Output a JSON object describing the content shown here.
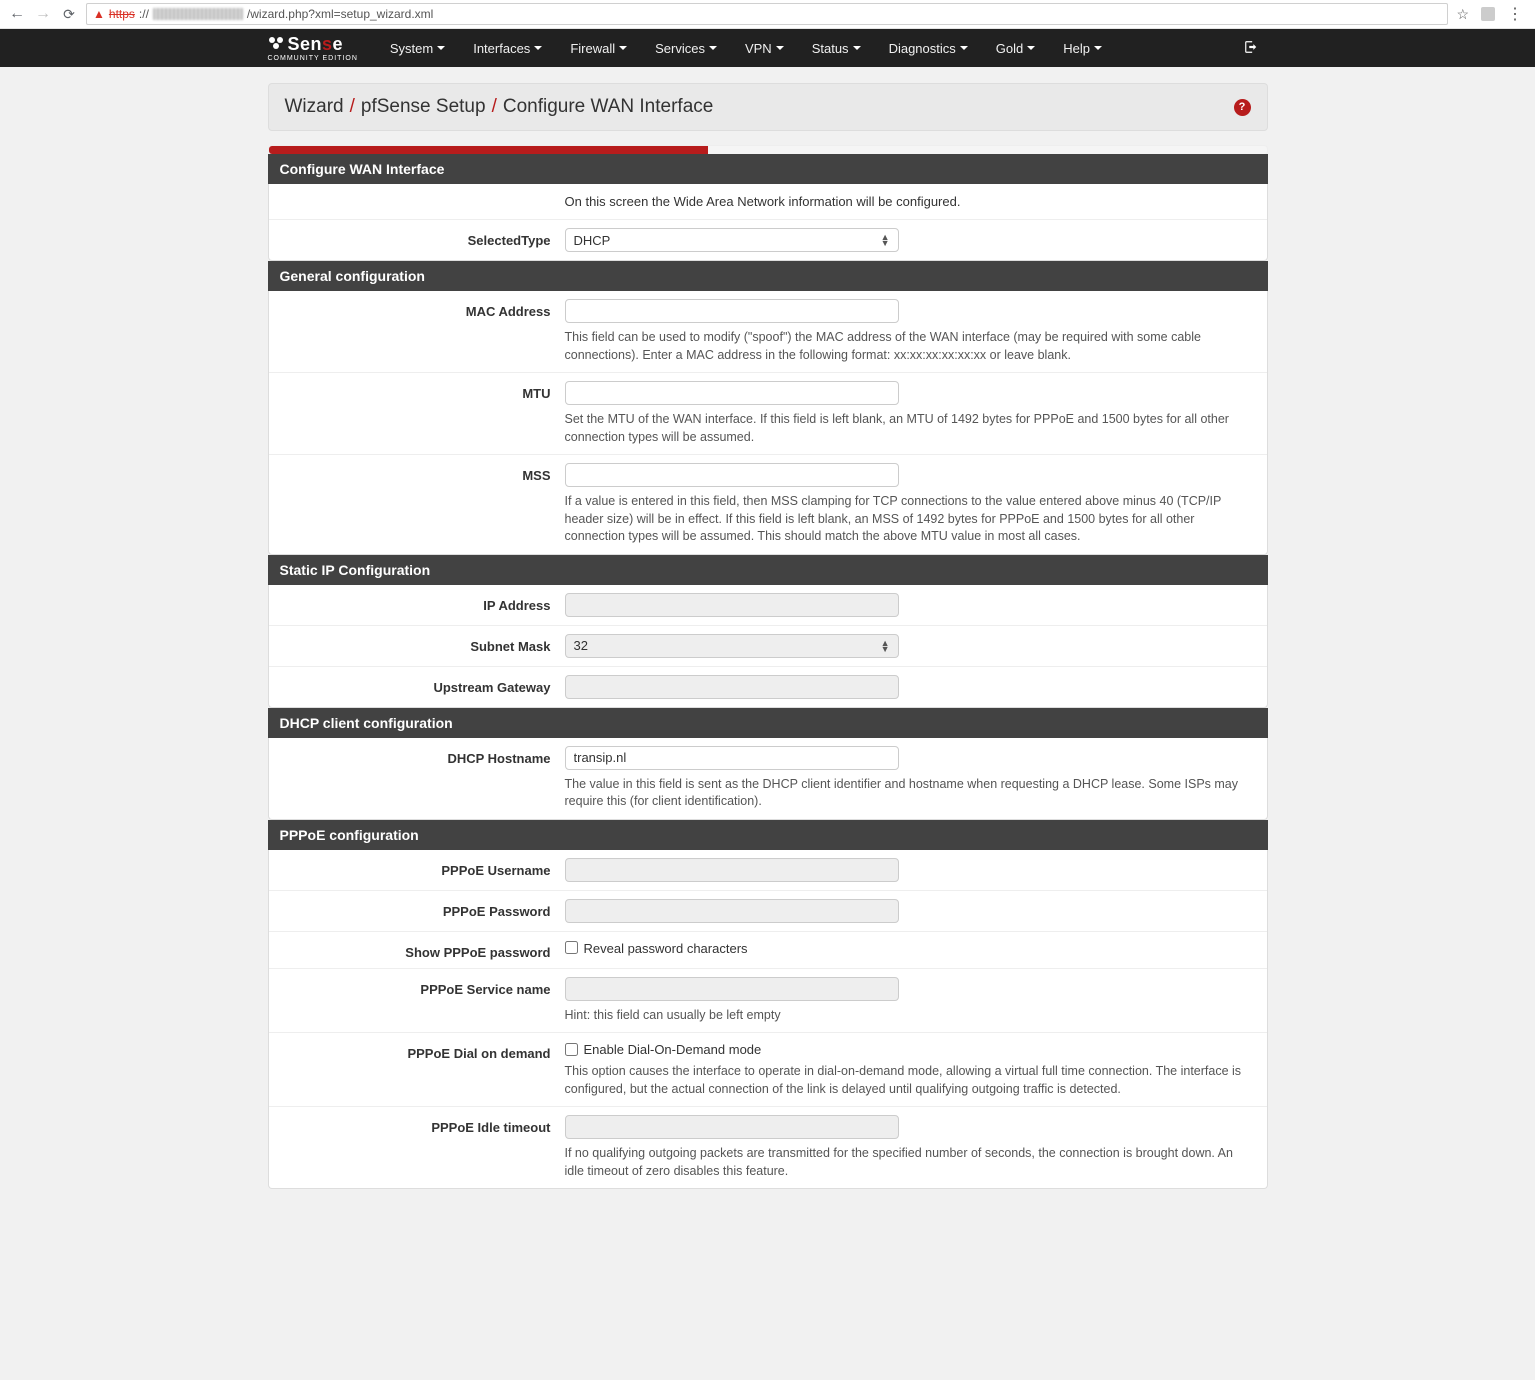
{
  "url": {
    "proto": "https",
    "path": "/wizard.php?xml=setup_wizard.xml"
  },
  "brand": {
    "name_pre": "Sen",
    "name_accent": "s",
    "name_post": "e",
    "subtitle": "COMMUNITY EDITION"
  },
  "nav": {
    "items": [
      "System",
      "Interfaces",
      "Firewall",
      "Services",
      "VPN",
      "Status",
      "Diagnostics",
      "Gold",
      "Help"
    ]
  },
  "breadcrumb": {
    "a": "Wizard",
    "b": "pfSense Setup",
    "c": "Configure WAN Interface"
  },
  "progress_percent": 44,
  "sections": {
    "wan": {
      "header": "Configure WAN Interface",
      "intro": "On this screen the Wide Area Network information will be configured.",
      "selectedtype_label": "SelectedType",
      "selectedtype_value": "DHCP"
    },
    "general": {
      "header": "General configuration",
      "mac_label": "MAC Address",
      "mac_help": "This field can be used to modify (\"spoof\") the MAC address of the WAN interface (may be required with some cable connections). Enter a MAC address in the following format: xx:xx:xx:xx:xx:xx or leave blank.",
      "mtu_label": "MTU",
      "mtu_help": "Set the MTU of the WAN interface. If this field is left blank, an MTU of 1492 bytes for PPPoE and 1500 bytes for all other connection types will be assumed.",
      "mss_label": "MSS",
      "mss_help": "If a value is entered in this field, then MSS clamping for TCP connections to the value entered above minus 40 (TCP/IP header size) will be in effect. If this field is left blank, an MSS of 1492 bytes for PPPoE and 1500 bytes for all other connection types will be assumed. This should match the above MTU value in most all cases."
    },
    "static": {
      "header": "Static IP Configuration",
      "ip_label": "IP Address",
      "subnet_label": "Subnet Mask",
      "subnet_value": "32",
      "gateway_label": "Upstream Gateway"
    },
    "dhcp": {
      "header": "DHCP client configuration",
      "hostname_label": "DHCP Hostname",
      "hostname_value": "transip.nl",
      "hostname_help": "The value in this field is sent as the DHCP client identifier and hostname when requesting a DHCP lease. Some ISPs may require this (for client identification)."
    },
    "pppoe": {
      "header": "PPPoE configuration",
      "user_label": "PPPoE Username",
      "pass_label": "PPPoE Password",
      "showpass_label": "Show PPPoE password",
      "showpass_cb": "Reveal password characters",
      "service_label": "PPPoE Service name",
      "service_help": "Hint: this field can usually be left empty",
      "dod_label": "PPPoE Dial on demand",
      "dod_cb": "Enable Dial-On-Demand mode",
      "dod_help": "This option causes the interface to operate in dial-on-demand mode, allowing a virtual full time connection. The interface is configured, but the actual connection of the link is delayed until qualifying outgoing traffic is detected.",
      "idle_label": "PPPoE Idle timeout",
      "idle_help": "If no qualifying outgoing packets are transmitted for the specified number of seconds, the connection is brought down. An idle timeout of zero disables this feature."
    }
  }
}
